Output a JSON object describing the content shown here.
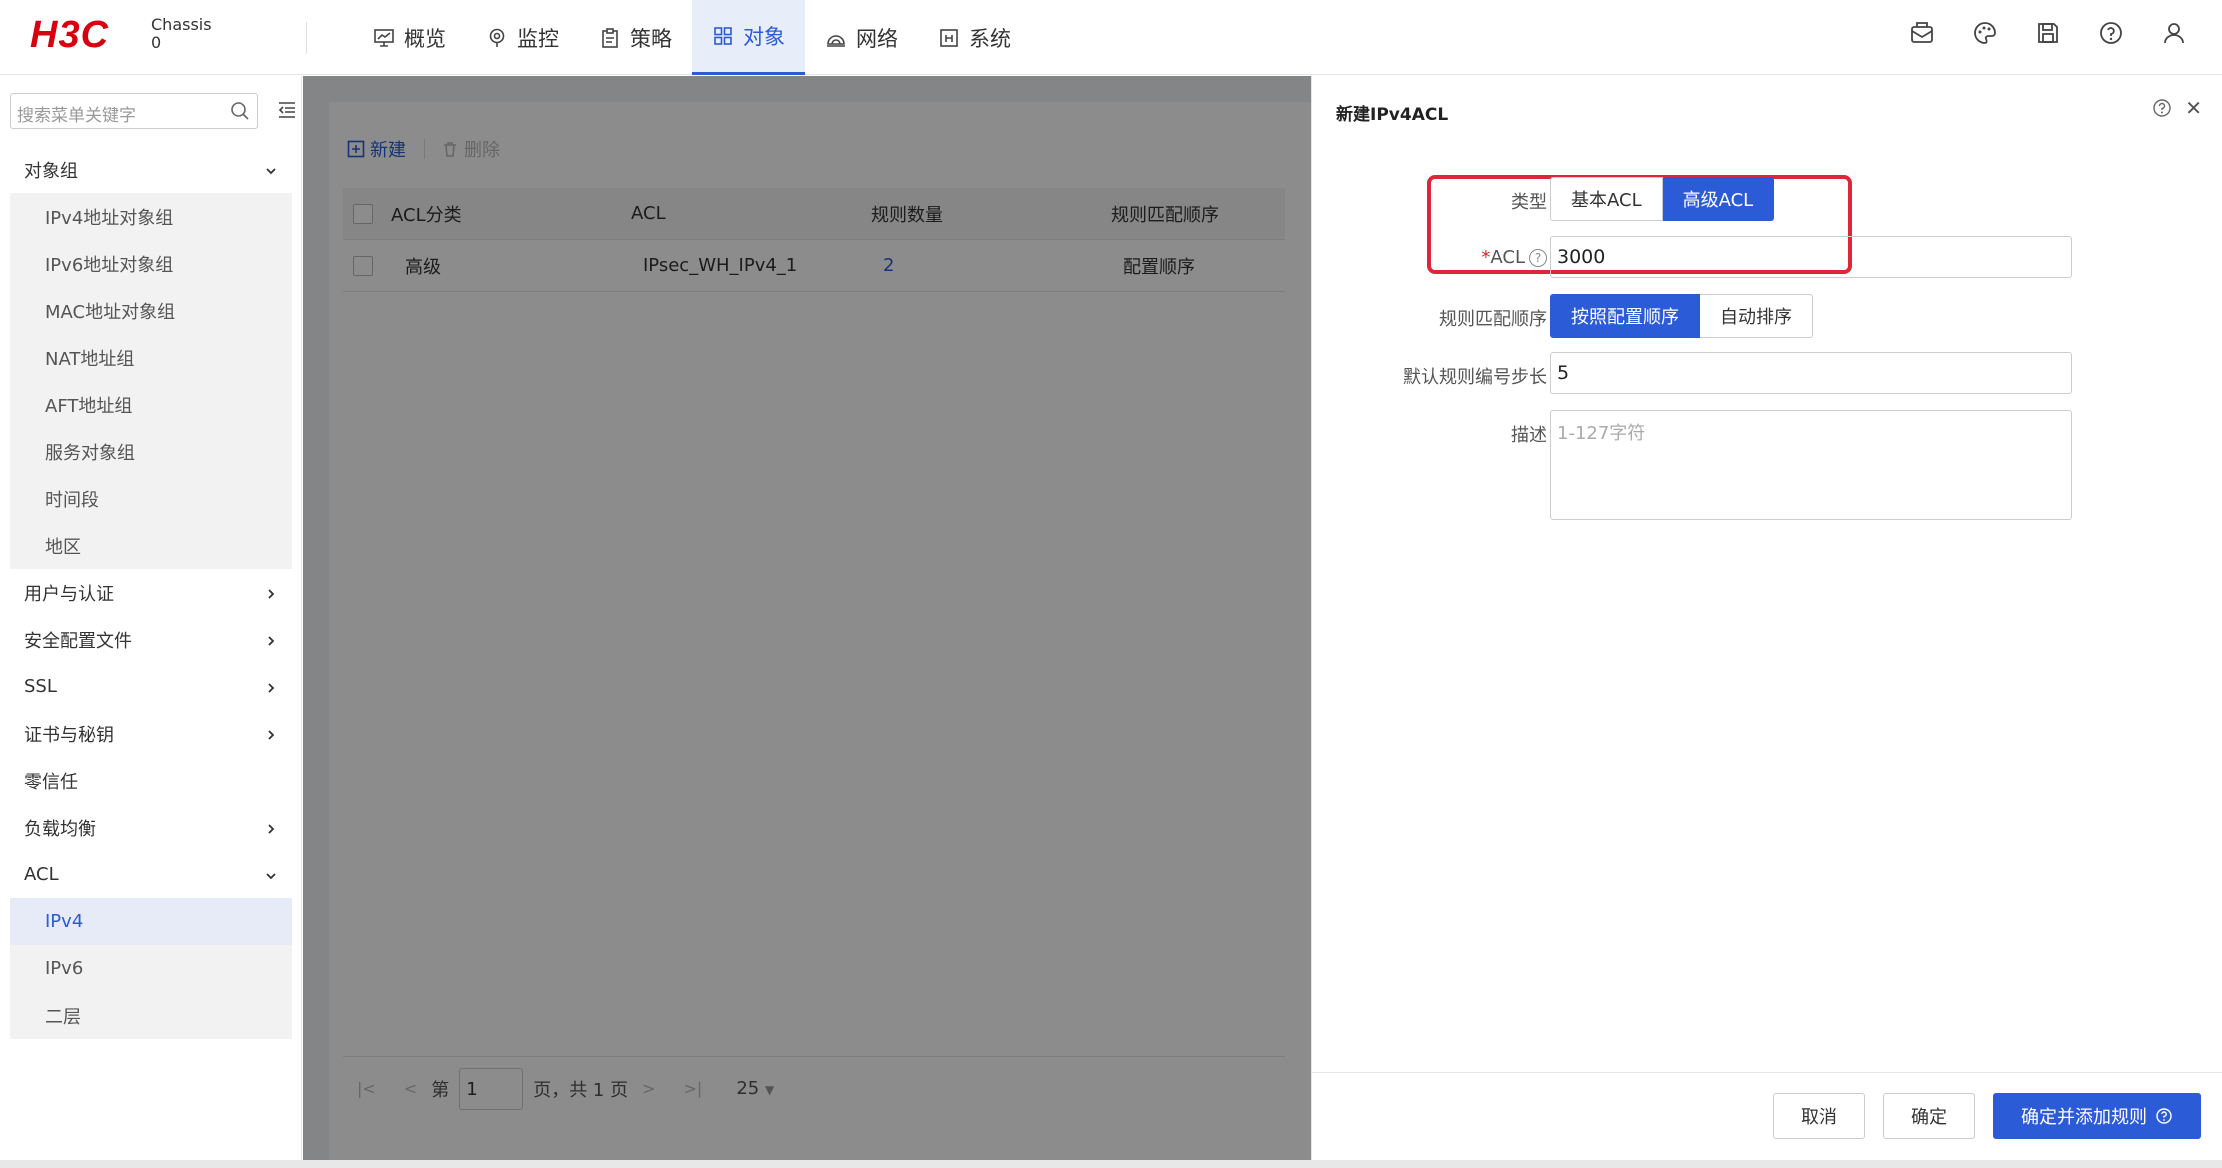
{
  "header": {
    "logo": "H3C",
    "device_name": "Chassis",
    "device_num": "0",
    "nav": [
      {
        "label": "概览",
        "icon": "monitor-icon"
      },
      {
        "label": "监控",
        "icon": "location-icon"
      },
      {
        "label": "策略",
        "icon": "clipboard-icon"
      },
      {
        "label": "对象",
        "icon": "grid-icon",
        "active": true
      },
      {
        "label": "网络",
        "icon": "router-icon"
      },
      {
        "label": "系统",
        "icon": "info-box-icon"
      }
    ],
    "right_icons": [
      "mail-icon",
      "palette-icon",
      "save-icon",
      "help-icon",
      "user-icon"
    ]
  },
  "sidebar": {
    "search_placeholder": "搜索菜单关键字",
    "groups": [
      {
        "label": "对象组",
        "expanded": true
      },
      {
        "label": "用户与认证"
      },
      {
        "label": "安全配置文件"
      },
      {
        "label": "SSL"
      },
      {
        "label": "证书与秘钥"
      },
      {
        "label": "零信任"
      },
      {
        "label": "负载均衡"
      },
      {
        "label": "ACL",
        "expanded": true
      }
    ],
    "object_items": [
      "IPv4地址对象组",
      "IPv6地址对象组",
      "MAC地址对象组",
      "NAT地址组",
      "AFT地址组",
      "服务对象组",
      "时间段",
      "地区"
    ],
    "acl_items": [
      "IPv4",
      "IPv6",
      "二层"
    ]
  },
  "content": {
    "toolbar": {
      "new": "新建",
      "delete": "删除"
    },
    "columns": [
      "ACL分类",
      "ACL",
      "规则数量",
      "规则匹配顺序"
    ],
    "rows": [
      {
        "category": "高级",
        "acl": "IPsec_WH_IPv4_1",
        "rule_count": "2",
        "order": "配置顺序"
      }
    ],
    "pager": {
      "prefix": "第",
      "page": "1",
      "suffix": "页，共 1 页",
      "page_size": "25"
    }
  },
  "drawer": {
    "title": "新建IPv4ACL",
    "type_label": "类型",
    "type_options": [
      "基本ACL",
      "高级ACL"
    ],
    "type_selected": "高级ACL",
    "acl_label": "ACL",
    "acl_required_mark": "*",
    "acl_value": "3000",
    "order_label": "规则匹配顺序",
    "order_options": [
      "按照配置顺序",
      "自动排序"
    ],
    "order_selected": "按照配置顺序",
    "step_label": "默认规则编号步长",
    "step_value": "5",
    "desc_label": "描述",
    "desc_placeholder": "1-127字符",
    "buttons": {
      "cancel": "取消",
      "ok": "确定",
      "ok_add": "确定并添加规则"
    }
  },
  "colors": {
    "accent": "#2b5bd7",
    "brand": "#d7000f",
    "highlight": "#e0243a"
  }
}
